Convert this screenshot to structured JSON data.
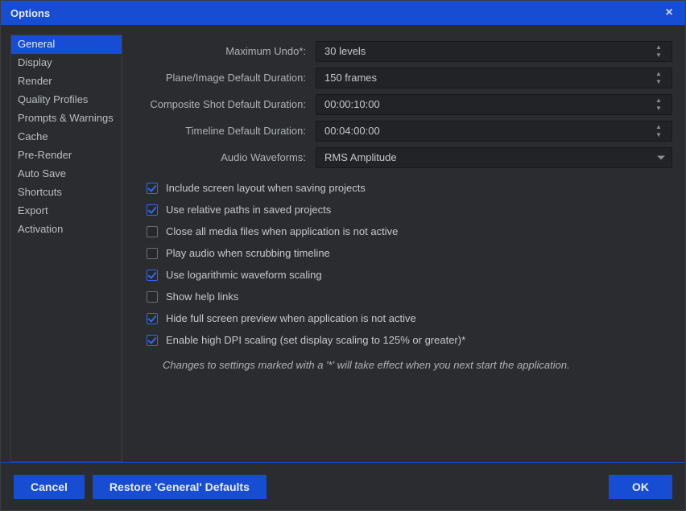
{
  "window": {
    "title": "Options"
  },
  "sidebar": {
    "items": [
      {
        "label": "General"
      },
      {
        "label": "Display"
      },
      {
        "label": "Render"
      },
      {
        "label": "Quality Profiles"
      },
      {
        "label": "Prompts & Warnings"
      },
      {
        "label": "Cache"
      },
      {
        "label": "Pre-Render"
      },
      {
        "label": "Auto Save"
      },
      {
        "label": "Shortcuts"
      },
      {
        "label": "Export"
      },
      {
        "label": "Activation"
      }
    ],
    "selected_index": 0
  },
  "form": {
    "maximum_undo": {
      "label": "Maximum Undo*:",
      "value": "30 levels"
    },
    "plane_duration": {
      "label": "Plane/Image Default Duration:",
      "value": "150 frames"
    },
    "composite_shot_duration": {
      "label": "Composite Shot Default Duration:",
      "value": "00:00:10:00"
    },
    "timeline_duration": {
      "label": "Timeline Default Duration:",
      "value": "00:04:00:00"
    },
    "audio_waveforms": {
      "label": "Audio Waveforms:",
      "value": "RMS Amplitude"
    }
  },
  "checks": {
    "include_layout": {
      "checked": true,
      "label": "Include screen layout when saving projects"
    },
    "relative_paths": {
      "checked": true,
      "label": "Use relative paths in saved projects"
    },
    "close_media": {
      "checked": false,
      "label": "Close all media files when application is not active"
    },
    "play_audio_scrub": {
      "checked": false,
      "label": "Play audio when scrubbing timeline"
    },
    "log_waveform": {
      "checked": true,
      "label": "Use logarithmic waveform scaling"
    },
    "show_help_links": {
      "checked": false,
      "label": "Show help links"
    },
    "hide_fullscreen": {
      "checked": true,
      "label": "Hide full screen preview when application is not active"
    },
    "high_dpi": {
      "checked": true,
      "label": "Enable high DPI scaling (set display scaling to 125% or greater)*"
    }
  },
  "note": "Changes to settings marked with a '*' will take effect when you next start the application.",
  "footer": {
    "cancel": "Cancel",
    "restore": "Restore 'General' Defaults",
    "ok": "OK"
  }
}
